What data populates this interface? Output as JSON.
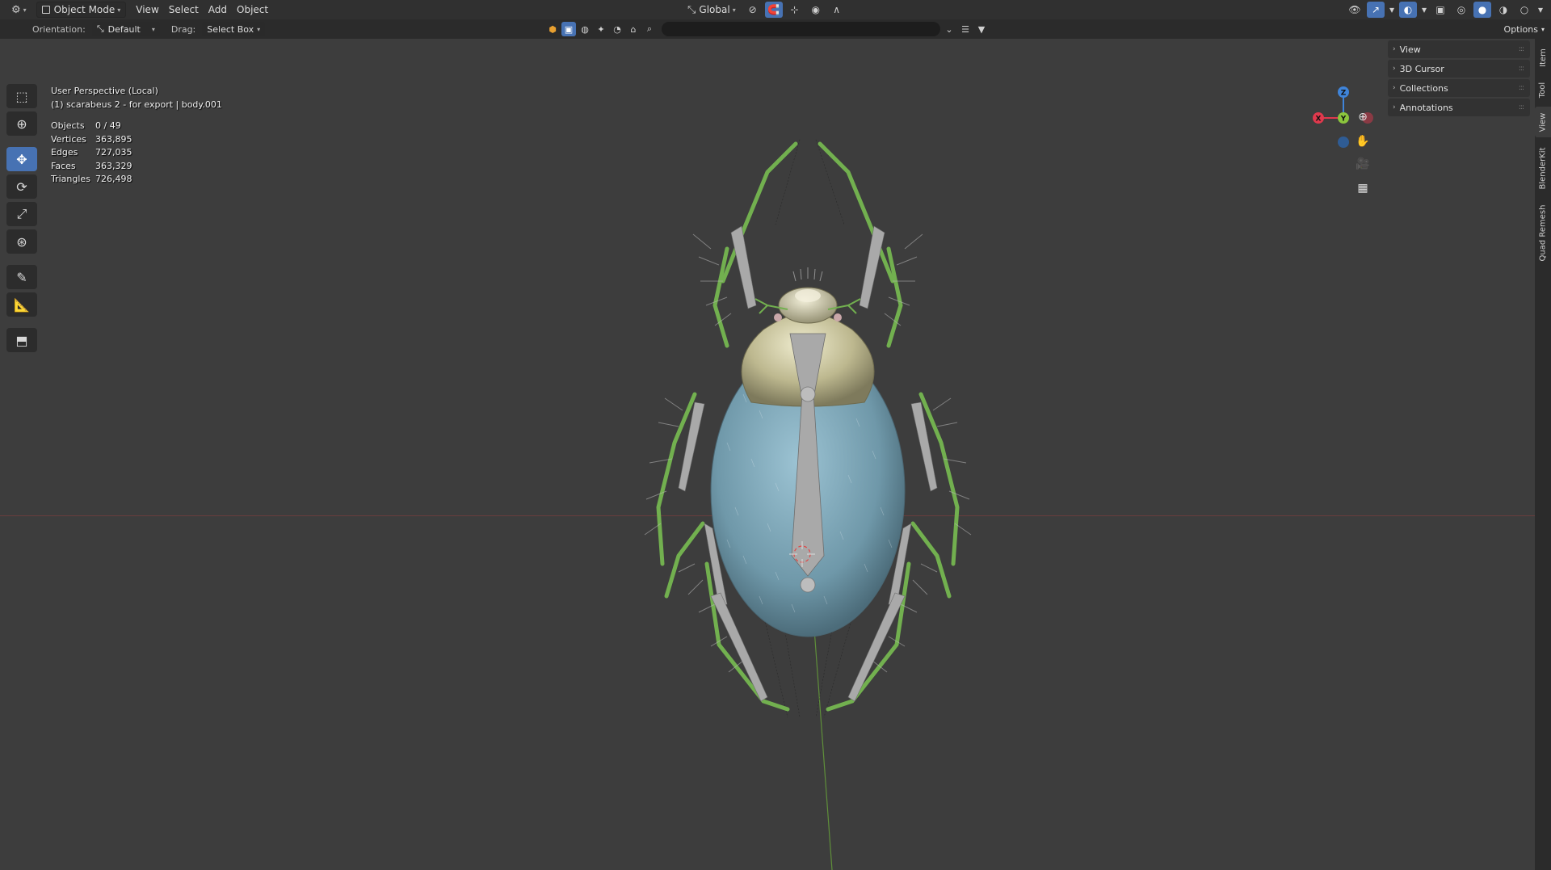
{
  "header": {
    "editor_type_icon": "3d-viewport-icon",
    "mode": "Object Mode",
    "menus": [
      "View",
      "Select",
      "Add",
      "Object"
    ],
    "transform_orientation": "Global"
  },
  "tool_settings": {
    "orientation_label": "Orientation:",
    "orientation_value": "Default",
    "drag_label": "Drag:",
    "drag_value": "Select Box",
    "options_label": "Options"
  },
  "viewport": {
    "perspective": "User Perspective (Local)",
    "object_info": "(1) scarabeus 2 - for export | body.001",
    "stats": [
      {
        "label": "Objects",
        "value": "0 / 49"
      },
      {
        "label": "Vertices",
        "value": "363,895"
      },
      {
        "label": "Edges",
        "value": "727,035"
      },
      {
        "label": "Faces",
        "value": "363,329"
      },
      {
        "label": "Triangles",
        "value": "726,498"
      }
    ],
    "gizmo": {
      "x": "X",
      "y": "Y",
      "z": "Z",
      "x_color": "#e0394d",
      "y_color": "#8bc53d",
      "z_color": "#3f84d9"
    }
  },
  "tools": [
    "select-box",
    "cursor",
    "move",
    "rotate",
    "scale",
    "transform",
    "annotate",
    "measure",
    "add-cube"
  ],
  "npanel": {
    "sections": [
      "View",
      "3D Cursor",
      "Collections",
      "Annotations"
    ]
  },
  "sidebar_tabs": [
    "Item",
    "Tool",
    "View",
    "BlenderKit",
    "Quad Remesh"
  ],
  "colors": {
    "accent": "#4772b3",
    "viewport_bg": "#3d3d3d",
    "elytra": "#7fa9bb",
    "pronotum": "#c9c4a0"
  }
}
